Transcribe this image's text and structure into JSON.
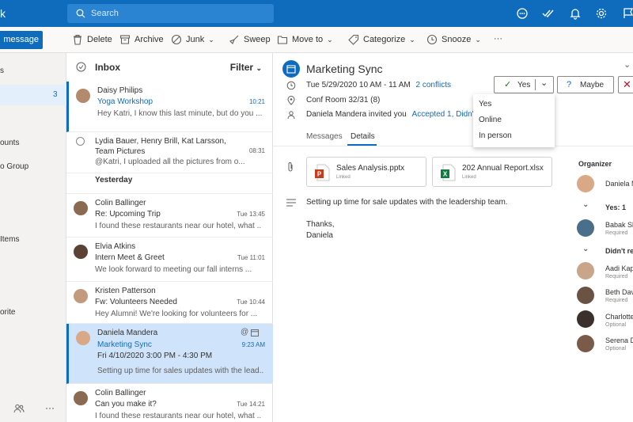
{
  "app": {
    "brand_fragment": "k"
  },
  "search": {
    "placeholder": "Search"
  },
  "commands": {
    "new_message": "message",
    "delete": "Delete",
    "archive": "Archive",
    "junk": "Junk",
    "sweep": "Sweep",
    "move_to": "Move to",
    "categorize": "Categorize",
    "snooze": "Snooze",
    "more": "···"
  },
  "leftnav": {
    "items": [
      {
        "label": "s"
      },
      {
        "label": "",
        "count": "3"
      },
      {
        "label": "ounts"
      },
      {
        "label": "o Group"
      },
      {
        "label": "Items"
      },
      {
        "label": "orite"
      }
    ],
    "more": "···"
  },
  "list": {
    "title": "Inbox",
    "filter": "Filter",
    "section_yesterday": "Yesterday",
    "messages": [
      {
        "sender": "Daisy Philips",
        "subject": "Yoga Workshop",
        "preview": "Hey Katri, I know this last minute, but do you ...",
        "time": "10:21"
      },
      {
        "sender": "Lydia Bauer, Henry Brill, Kat Larsson,",
        "subject": "Team Pictures",
        "preview": "@Katri, I uploaded all the pictures from o...",
        "time": "08:31"
      },
      {
        "sender": "Colin Ballinger",
        "subject": "Re: Upcoming Trip",
        "preview": "I found these restaurants near our hotel, what ...",
        "time": "Tue 13:45"
      },
      {
        "sender": "Elvia Atkins",
        "subject": "Intern Meet & Greet",
        "preview": "We look forward to meeting our fall interns ...",
        "time": "Tue 11:01"
      },
      {
        "sender": "Kristen Patterson",
        "subject": "Fw: Volunteers Needed",
        "preview": "Hey Alumni! We're looking for volunteers for ...",
        "time": "Tue 10:44"
      },
      {
        "sender": "Daniela Mandera",
        "subject": "Marketing Sync",
        "preview": "Setting up time for sales updates with the lead...",
        "date": "Fri 4/10/2020 3:00 PM - 4:30 PM",
        "time": "9:23 AM"
      },
      {
        "sender": "Colin Ballinger",
        "subject": "Can you make it?",
        "preview": "I found these restaurants near our hotel, what ...",
        "time": "Tue 14:21"
      }
    ]
  },
  "event": {
    "title": "Marketing Sync",
    "datetime": "Tue 5/29/2020 10 AM - 11 AM",
    "conflicts": "2 conflicts",
    "location": "Conf Room 32/31 (8)",
    "invited": "Daniela Mandera invited you",
    "accepted": "Accepted 1, Didn't",
    "tab_messages": "Messages",
    "tab_details": "Details",
    "attachments": [
      {
        "name": "Sales Analysis.pptx",
        "status": "Linked"
      },
      {
        "name": "202 Annual Report.xlsx",
        "status": "Linked"
      }
    ],
    "body": "Setting up time for sale updates with the leadership team.",
    "signoff": "Thanks,",
    "signature": "Daniela",
    "yes": "Yes",
    "maybe": "Maybe",
    "dropdown": [
      "Yes",
      "Online",
      "In person"
    ],
    "organizer_label": "Organizer",
    "organizer": "Daniela M",
    "yes_group": "Yes: 1",
    "didnt_group": "Didn't re",
    "attendees": [
      {
        "name": "Babak Sh",
        "role": "Required"
      },
      {
        "name": "Aadi Kap",
        "role": "Required"
      },
      {
        "name": "Beth Dav",
        "role": "Required"
      },
      {
        "name": "Charlotte",
        "role": "Optional"
      },
      {
        "name": "Serena D",
        "role": "Optional"
      }
    ]
  },
  "colors": {
    "brand": "#0f6cbd",
    "selected_row": "#cfe4fa",
    "decline": "#c50f1f"
  }
}
